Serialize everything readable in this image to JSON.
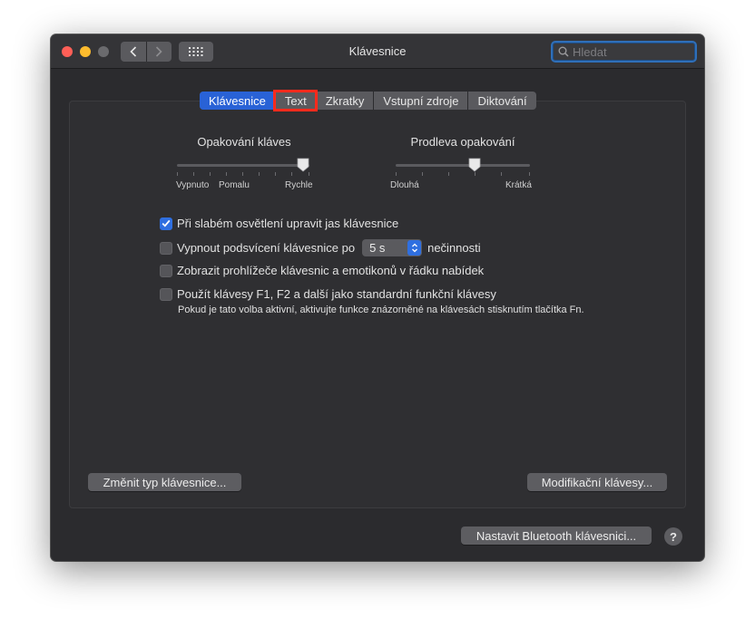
{
  "window": {
    "title": "Klávesnice",
    "search_placeholder": "Hledat"
  },
  "tabs": [
    {
      "label": "Klávesnice",
      "selected": true
    },
    {
      "label": "Text",
      "selected": false,
      "highlighted": true
    },
    {
      "label": "Zkratky",
      "selected": false
    },
    {
      "label": "Vstupní zdroje",
      "selected": false
    },
    {
      "label": "Diktování",
      "selected": false
    }
  ],
  "key_repeat": {
    "title": "Opakování kláves",
    "labels": [
      "Vypnuto",
      "Pomalu",
      "Rychle"
    ],
    "value_fraction": 0.95
  },
  "repeat_delay": {
    "title": "Prodleva opakování",
    "labels": [
      "Dlouhá",
      "Krátká"
    ],
    "value_fraction": 0.59
  },
  "options": {
    "adjust_brightness": {
      "label": "Při slabém osvětlení upravit jas klávesnice",
      "checked": true
    },
    "backlight_off": {
      "label_before": "Vypnout podsvícení klávesnice po",
      "popup_value": "5 s",
      "label_after": "nečinnosti",
      "checked": false
    },
    "show_viewers": {
      "label": "Zobrazit prohlížeče klávesnic a emotikonů v řádku nabídek",
      "checked": false
    },
    "fn_keys": {
      "label": "Použít klávesy F1, F2 a další jako standardní funkční klávesy",
      "note": "Pokud je tato volba aktivní, aktivujte funkce znázorněné na klávesách stisknutím tlačítka Fn.",
      "checked": false
    }
  },
  "buttons": {
    "change_type": "Změnit typ klávesnice...",
    "modifier_keys": "Modifikační klávesy...",
    "bluetooth": "Nastavit Bluetooth klávesnici...",
    "help": "?"
  },
  "colors": {
    "accent": "#2962d6",
    "highlight_outline": "#ff2a1c",
    "window_bg": "#2b2b2e"
  }
}
